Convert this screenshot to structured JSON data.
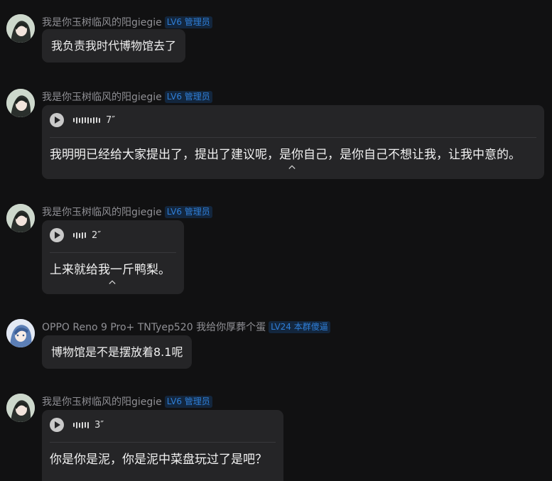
{
  "messages": [
    {
      "nickname": "我是你玉树临风的阳giegie",
      "badge": "LV6 管理员",
      "avatar": "anime-avatar-dark-hair",
      "type": "text",
      "text": "我负责我时代博物馆去了"
    },
    {
      "nickname": "我是你玉树临风的阳giegie",
      "badge": "LV6 管理员",
      "avatar": "anime-avatar-dark-hair",
      "type": "voice",
      "duration": "7″",
      "transcript": "我明明已经给大家提出了，提出了建议呢，是你自己，是你自己不想让我，让我中意的。"
    },
    {
      "nickname": "我是你玉树临风的阳giegie",
      "badge": "LV6 管理员",
      "avatar": "anime-avatar-dark-hair",
      "type": "voice",
      "duration": "2″",
      "transcript": "上来就给我一斤鸭梨。"
    },
    {
      "nickname": "OPPO Reno 9 Pro+ TNTyep520 我给你厚葬个蛋",
      "badge": "LV24 本群傻逼",
      "avatar": "anime-avatar-blue-hair",
      "type": "text",
      "text": "博物馆是不是摆放着8.1呢"
    },
    {
      "nickname": "我是你玉树临风的阳giegie",
      "badge": "LV6 管理员",
      "avatar": "anime-avatar-dark-hair",
      "type": "voice",
      "duration": "3″",
      "transcript": "你是你是泥，你是泥中菜盘玩过了是吧？"
    }
  ],
  "colors": {
    "background": "#111112",
    "bubble": "#252527",
    "badge_text": "#2f7fd8",
    "nickname": "#8f8f94"
  }
}
